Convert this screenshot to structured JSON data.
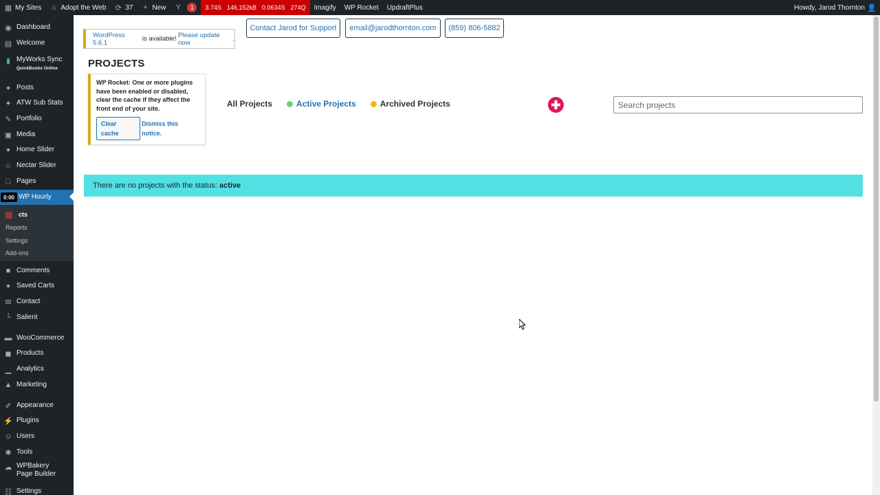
{
  "adminbar": {
    "my_sites": "My Sites",
    "site_name": "Adopt the Web",
    "updates_count": "37",
    "new_label": "New",
    "yoast_badge": "1",
    "perf": [
      "3.74S",
      "146,152kB",
      "0.0634S",
      "274Q"
    ],
    "imagify": "Imagify",
    "wp_rocket": "WP Rocket",
    "updraft": "UpdraftPlus",
    "howdy": "Howdy, Jarod Thornton"
  },
  "sidebar": {
    "items": [
      {
        "label": "Dashboard",
        "icon": "dashboard-icon"
      },
      {
        "label": "Welcome",
        "icon": "welcome-icon"
      },
      {
        "label": "MyWorks Sync",
        "sublabel": "QuickBooks Online",
        "icon": "sync-icon"
      },
      {
        "label": "Posts",
        "icon": "pin-icon"
      },
      {
        "label": "ATW Sub Stats",
        "icon": "pin-icon"
      },
      {
        "label": "Portfolio",
        "icon": "portfolio-icon"
      },
      {
        "label": "Media",
        "icon": "media-icon"
      },
      {
        "label": "Home Slider",
        "icon": "pin-icon"
      },
      {
        "label": "Nectar Slider",
        "icon": "star-icon"
      },
      {
        "label": "Pages",
        "icon": "pages-icon"
      },
      {
        "label": "WP Hourly",
        "icon": "clock-icon"
      },
      {
        "label": "Comments",
        "icon": "comment-icon"
      },
      {
        "label": "Saved Carts",
        "icon": "pin-icon"
      },
      {
        "label": "Contact",
        "icon": "mail-icon"
      },
      {
        "label": "Salient",
        "icon": "chart-icon"
      },
      {
        "label": "WooCommerce",
        "icon": "woo-icon"
      },
      {
        "label": "Products",
        "icon": "products-icon"
      },
      {
        "label": "Analytics",
        "icon": "analytics-icon"
      },
      {
        "label": "Marketing",
        "icon": "megaphone-icon"
      },
      {
        "label": "Appearance",
        "icon": "brush-icon"
      },
      {
        "label": "Plugins",
        "icon": "plugin-icon"
      },
      {
        "label": "Users",
        "icon": "users-icon"
      },
      {
        "label": "Tools",
        "icon": "wrench-icon"
      },
      {
        "label": "WPBakery Page Builder",
        "icon": "builder-icon"
      },
      {
        "label": "Settings",
        "icon": "settings-icon"
      }
    ],
    "timer": "0:00",
    "submenu": [
      "cts",
      "Reports",
      "Settings",
      "Add-ons"
    ]
  },
  "main": {
    "update_nag": {
      "version_link": "WordPress 5.6.1",
      "middle": " is available! ",
      "update_link": "Please update now",
      "end": "."
    },
    "contact_support": "Contact Jarod for Support",
    "email": "email@jarodthornton.com",
    "phone": "(859) 806-5882",
    "page_title": "PROJECTS",
    "rocket_notice": {
      "title": "WP Rocket",
      "text": ": One or more plugins have been enabled or disabled, clear the cache if they affect the front end of your site.",
      "clear_cache": "Clear cache",
      "dismiss": "Dismiss this notice."
    },
    "filters": [
      {
        "label": "All Projects",
        "dot": ""
      },
      {
        "label": "Active Projects",
        "dot": "#6fcf6f"
      },
      {
        "label": "Archived Projects",
        "dot": "#f5b800"
      }
    ],
    "search_placeholder": "Search projects",
    "status_message": "There are no projects with the status:",
    "status_value": "active"
  }
}
